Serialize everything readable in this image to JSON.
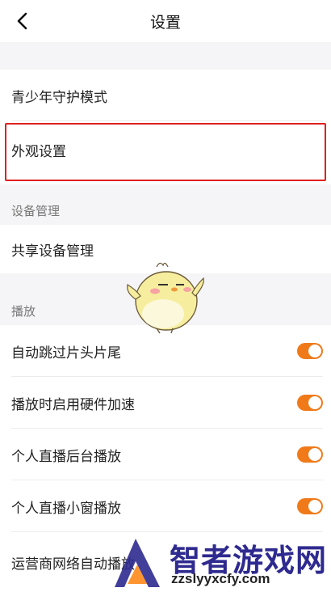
{
  "header": {
    "title": "设置"
  },
  "rows": {
    "youth_mode": "青少年守护模式",
    "appearance": "外观设置",
    "device_section": "设备管理",
    "shared_device": "共享设备管理",
    "playback_section": "播放",
    "skip_intro": "自动跳过片头片尾",
    "hw_accel": "播放时启用硬件加速",
    "live_background": "个人直播后台播放",
    "live_pip": "个人直播小窗播放",
    "carrier": "运营商网络自动播放"
  },
  "toggles": {
    "skip_intro": true,
    "hw_accel": true,
    "live_background": true,
    "live_pip": true
  },
  "watermark": {
    "brand": "智者游戏网",
    "url": "zzslyyxcfy.com"
  },
  "colors": {
    "accent": "#f07a1a",
    "highlight_border": "#e02020",
    "gap_bg": "#f5f5f7"
  }
}
